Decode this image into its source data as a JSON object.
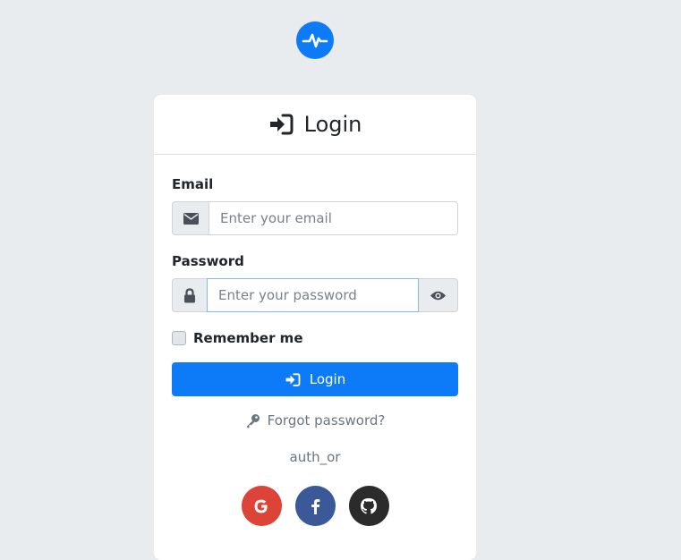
{
  "colors": {
    "primary": "#0d7bf7",
    "google": "#dc4437",
    "facebook": "#3b5998",
    "github": "#2b2b2b"
  },
  "logo": {
    "icon": "pulse-icon"
  },
  "card": {
    "title": "Login",
    "title_icon": "sign-in-icon"
  },
  "form": {
    "email": {
      "label": "Email",
      "icon": "envelope-icon",
      "value": "",
      "placeholder": "Enter your email"
    },
    "password": {
      "label": "Password",
      "icon": "lock-icon",
      "value": "",
      "placeholder": "Enter your password",
      "toggle_icon": "eye-icon"
    },
    "remember": {
      "label": "Remember me",
      "checked": false
    },
    "submit_label": "Login",
    "submit_icon": "sign-in-icon"
  },
  "links": {
    "forgot_label": "Forgot password?",
    "forgot_icon": "key-icon"
  },
  "divider_text": "auth_or",
  "social": [
    {
      "name": "google",
      "icon": "google-icon",
      "letter": "G"
    },
    {
      "name": "facebook",
      "icon": "facebook-icon",
      "letter": "f"
    },
    {
      "name": "github",
      "icon": "github-icon"
    }
  ]
}
